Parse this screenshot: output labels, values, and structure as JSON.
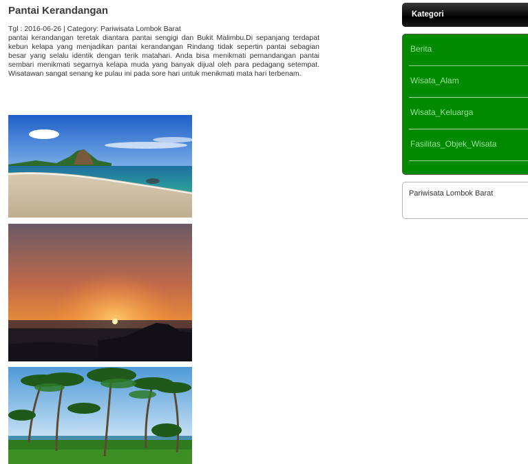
{
  "article": {
    "title": "Pantai Kerandangan",
    "meta": "Tgl : 2016-06-26 | Category: Pariwisata Lombok Barat",
    "body": "pantai kerandangan teretak diantara pantai sengigi dan Bukit Malimbu.Di sepanjang terdapat kebun kelapa yang menjadikan pantai kerandangan Rindang tidak sepertin pantai sebagian besar yang selalu identik dengan terik matahari. Anda bisa menikmati pemandangan pantai sembari menikmati segarnya kelapa muda yang banyak dijual oleh para pedagang setempat. Wisatawan sangat senang ke pulau ini pada sore hari untuk menikmati mata hari terbenam."
  },
  "sidebar": {
    "header": "Kategori",
    "categories": [
      {
        "label": "Berita"
      },
      {
        "label": "Wisata_Alam"
      },
      {
        "label": "Wisata_Keluarga"
      },
      {
        "label": "Fasilitas_Objek_Wisata"
      }
    ],
    "subcategory": "Pariwisata Lombok Barat"
  },
  "colors": {
    "category_bg": "#008a00",
    "category_text": "#9fe09f",
    "header_bg": "#000000"
  }
}
